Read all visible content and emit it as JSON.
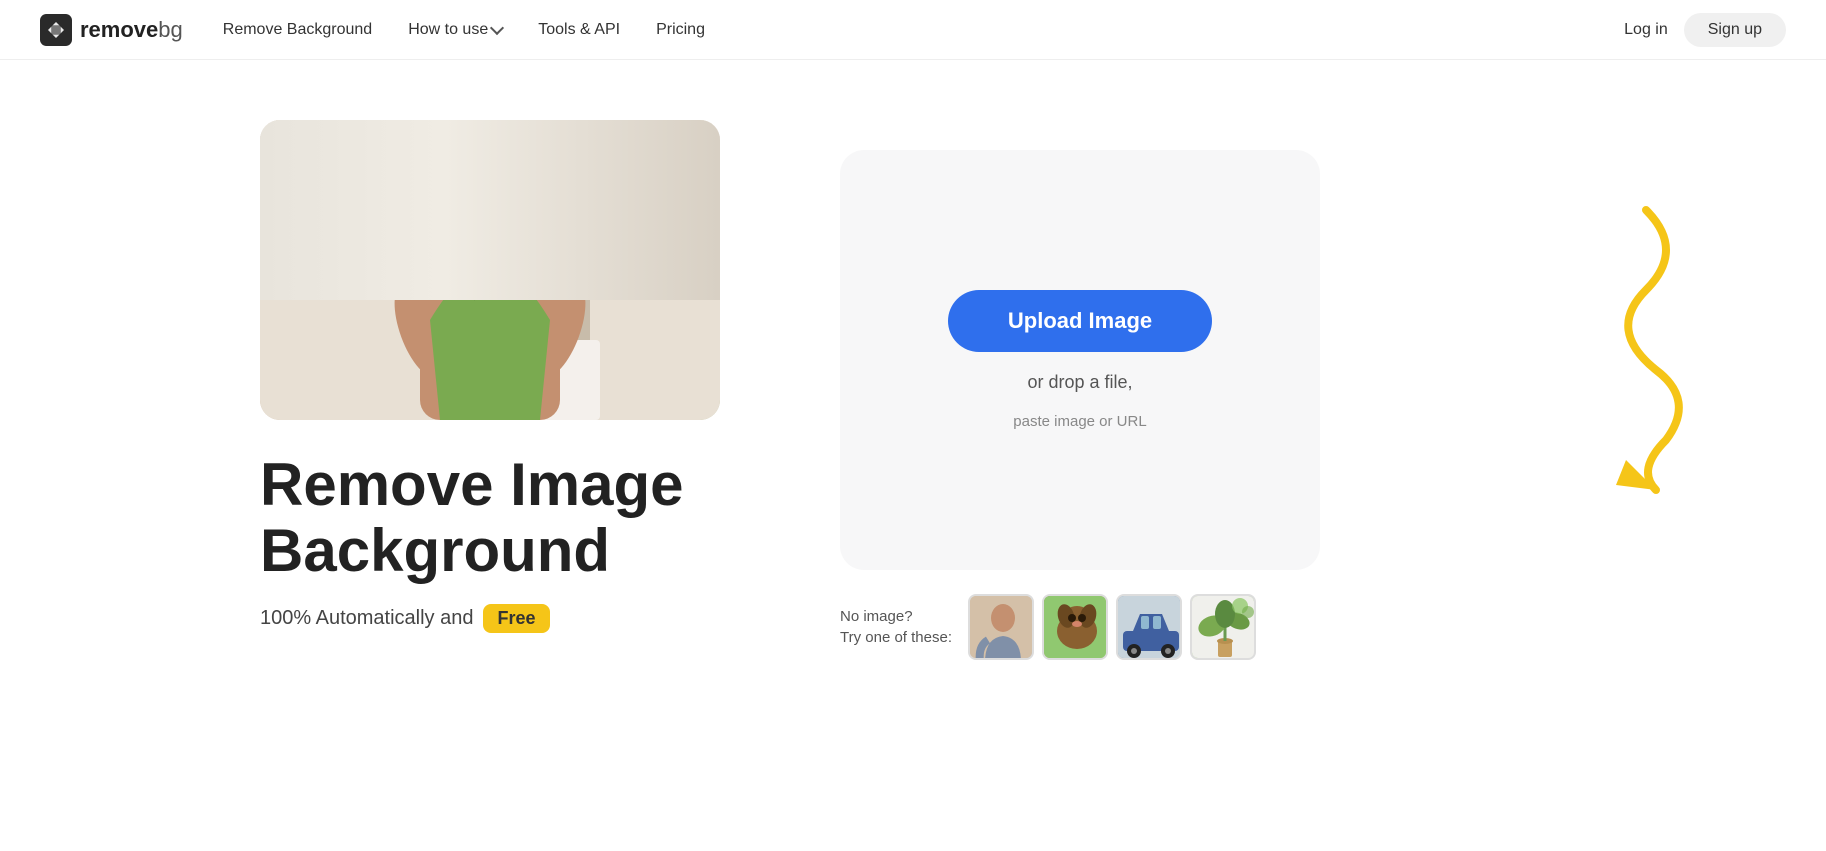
{
  "nav": {
    "logo_text_remove": "remove",
    "logo_text_bg": "bg",
    "links": [
      {
        "id": "remove-background",
        "label": "Remove Background",
        "hasDropdown": false
      },
      {
        "id": "how-to-use",
        "label": "How to use",
        "hasDropdown": true
      },
      {
        "id": "tools-api",
        "label": "Tools & API",
        "hasDropdown": false
      },
      {
        "id": "pricing",
        "label": "Pricing",
        "hasDropdown": false
      }
    ],
    "login_label": "Log in",
    "signup_label": "Sign up"
  },
  "hero": {
    "title_line1": "Remove Image",
    "title_line2": "Background",
    "subtitle_prefix": "100% Automatically and",
    "badge_label": "Free"
  },
  "upload": {
    "button_label": "Upload Image",
    "drop_text": "or drop a file,",
    "paste_text": "paste image or URL"
  },
  "samples": {
    "no_image_label": "No image?",
    "try_label": "Try one of these:",
    "thumbs": [
      {
        "id": "person",
        "alt": "Person sample"
      },
      {
        "id": "dog",
        "alt": "Dog sample"
      },
      {
        "id": "car",
        "alt": "Car sample"
      },
      {
        "id": "plant",
        "alt": "Plant sample"
      }
    ]
  },
  "decorations": {
    "squiggle_color": "#f5c518",
    "triangle_color": "#f5c518"
  }
}
